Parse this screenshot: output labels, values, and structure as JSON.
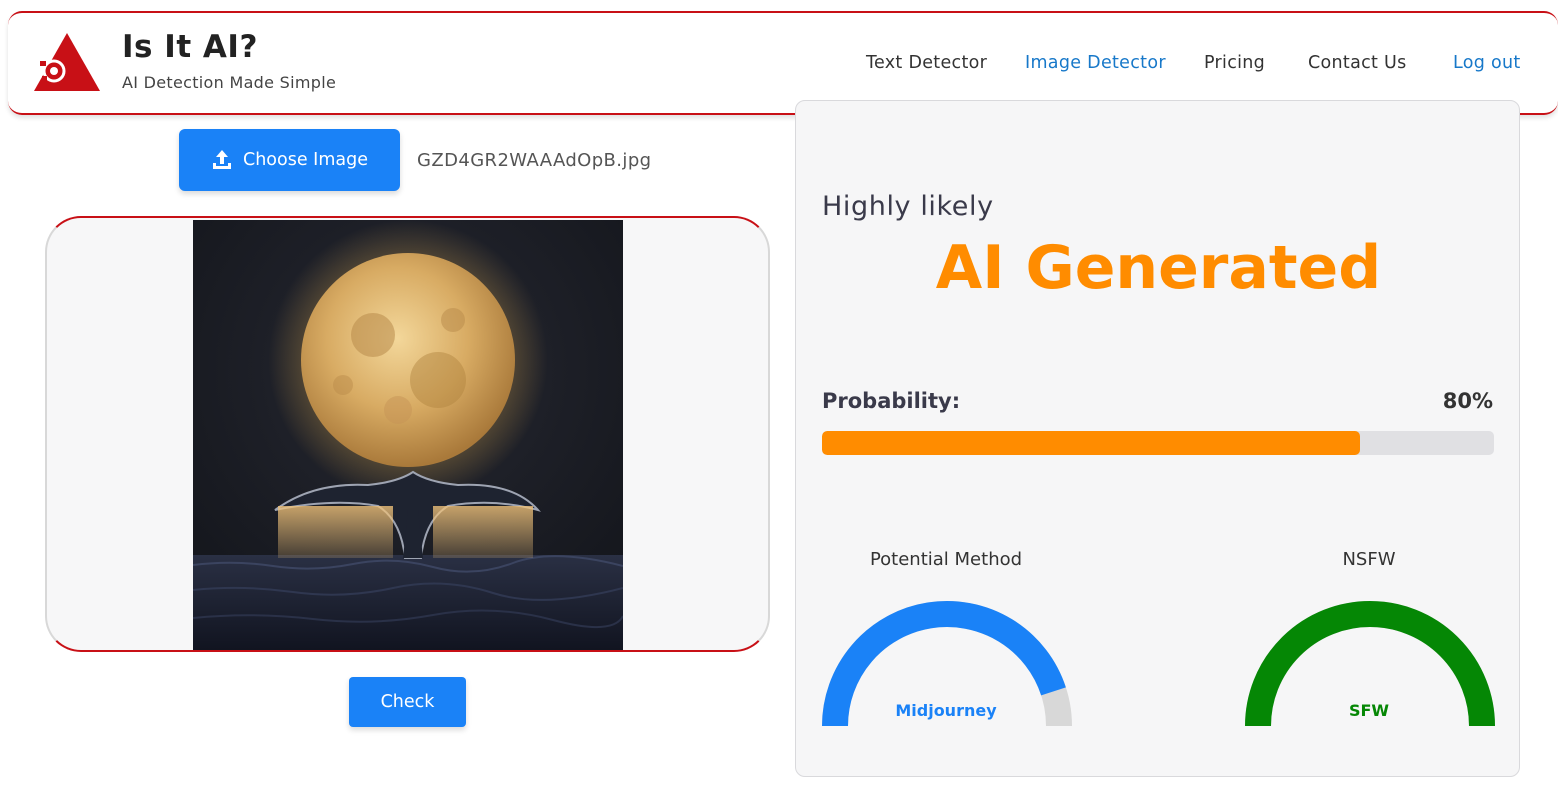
{
  "brand": {
    "title": "Is It AI?",
    "subtitle": "AI Detection Made Simple"
  },
  "nav": {
    "items": [
      {
        "label": "Text Detector"
      },
      {
        "label": "Image Detector"
      },
      {
        "label": "Pricing"
      },
      {
        "label": "Contact Us"
      },
      {
        "label": "Log out"
      }
    ]
  },
  "upload": {
    "button_label": "Choose Image",
    "filename": "GZD4GR2WAAAdOpB.jpg"
  },
  "actions": {
    "check_label": "Check"
  },
  "result": {
    "likelihood": "Highly likely",
    "verdict": "AI Generated",
    "probability_label": "Probability:",
    "probability_value": "80%",
    "probability_fraction": 0.8
  },
  "gauges": {
    "method": {
      "title": "Potential Method",
      "value": "Midjourney",
      "fraction": 0.9
    },
    "nsfw": {
      "title": "NSFW",
      "value": "SFW",
      "fraction": 1.0
    }
  },
  "colors": {
    "brand_red": "#c81016",
    "primary_blue": "#1a82f7",
    "verdict_orange": "#ff8c00",
    "gauge_blue": "#1a82f7",
    "gauge_green": "#058705",
    "gauge_track": "#d8d8d8"
  },
  "icons": {
    "logo": "red-triangle-robot-logo",
    "upload": "upload-icon"
  }
}
